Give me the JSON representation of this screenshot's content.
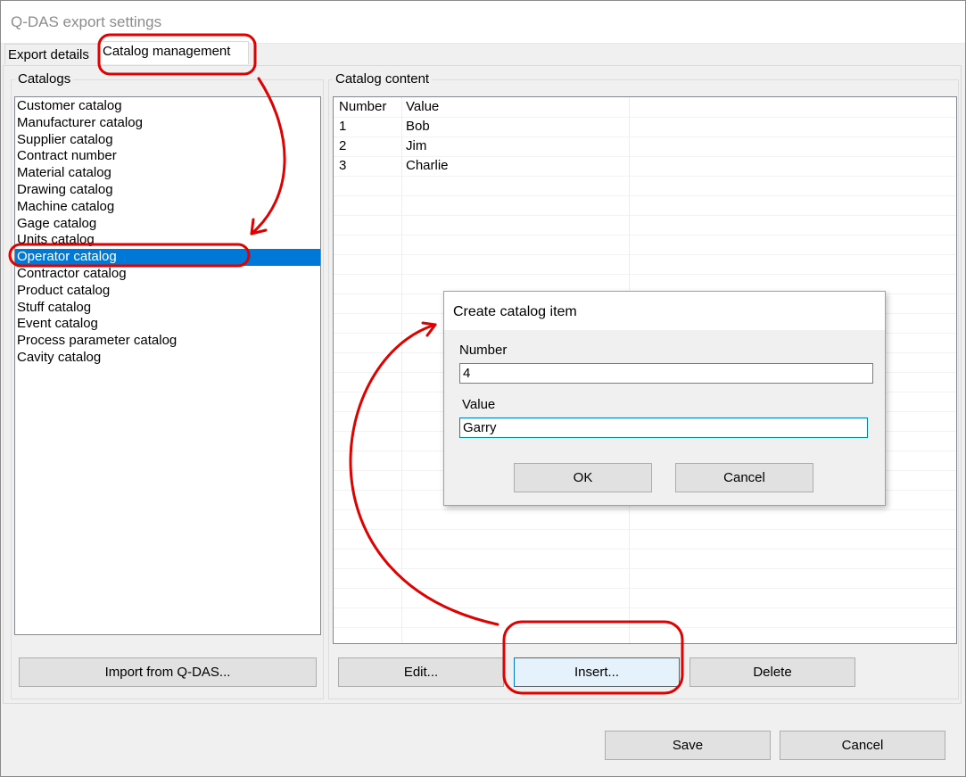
{
  "window": {
    "title": "Q-DAS export settings"
  },
  "tabs": [
    {
      "label": "Export details"
    },
    {
      "label": "Catalog management"
    }
  ],
  "catalogs": {
    "group_label": "Catalogs",
    "items": [
      "Customer catalog",
      "Manufacturer catalog",
      "Supplier catalog",
      "Contract number",
      "Material catalog",
      "Drawing catalog",
      "Machine catalog",
      "Gage catalog",
      "Units catalog",
      "Operator catalog",
      "Contractor catalog",
      "Product catalog",
      "Stuff catalog",
      "Event catalog",
      "Process parameter catalog",
      "Cavity catalog"
    ],
    "selected": "Operator catalog",
    "import_button": "Import from Q-DAS..."
  },
  "content": {
    "group_label": "Catalog content",
    "columns": [
      "Number",
      "Value"
    ],
    "rows": [
      {
        "number": "1",
        "value": "Bob"
      },
      {
        "number": "2",
        "value": "Jim"
      },
      {
        "number": "3",
        "value": "Charlie"
      }
    ],
    "edit_button": "Edit...",
    "insert_button": "Insert...",
    "delete_button": "Delete"
  },
  "dialog": {
    "title": "Create catalog item",
    "number_label": "Number",
    "number_value": "4",
    "value_label": "Value",
    "value_value": "Garry",
    "ok_button": "OK",
    "cancel_button": "Cancel"
  },
  "footer": {
    "save_button": "Save",
    "cancel_button": "Cancel"
  },
  "colors": {
    "selection": "#0078d7",
    "annotation": "#e00000"
  }
}
